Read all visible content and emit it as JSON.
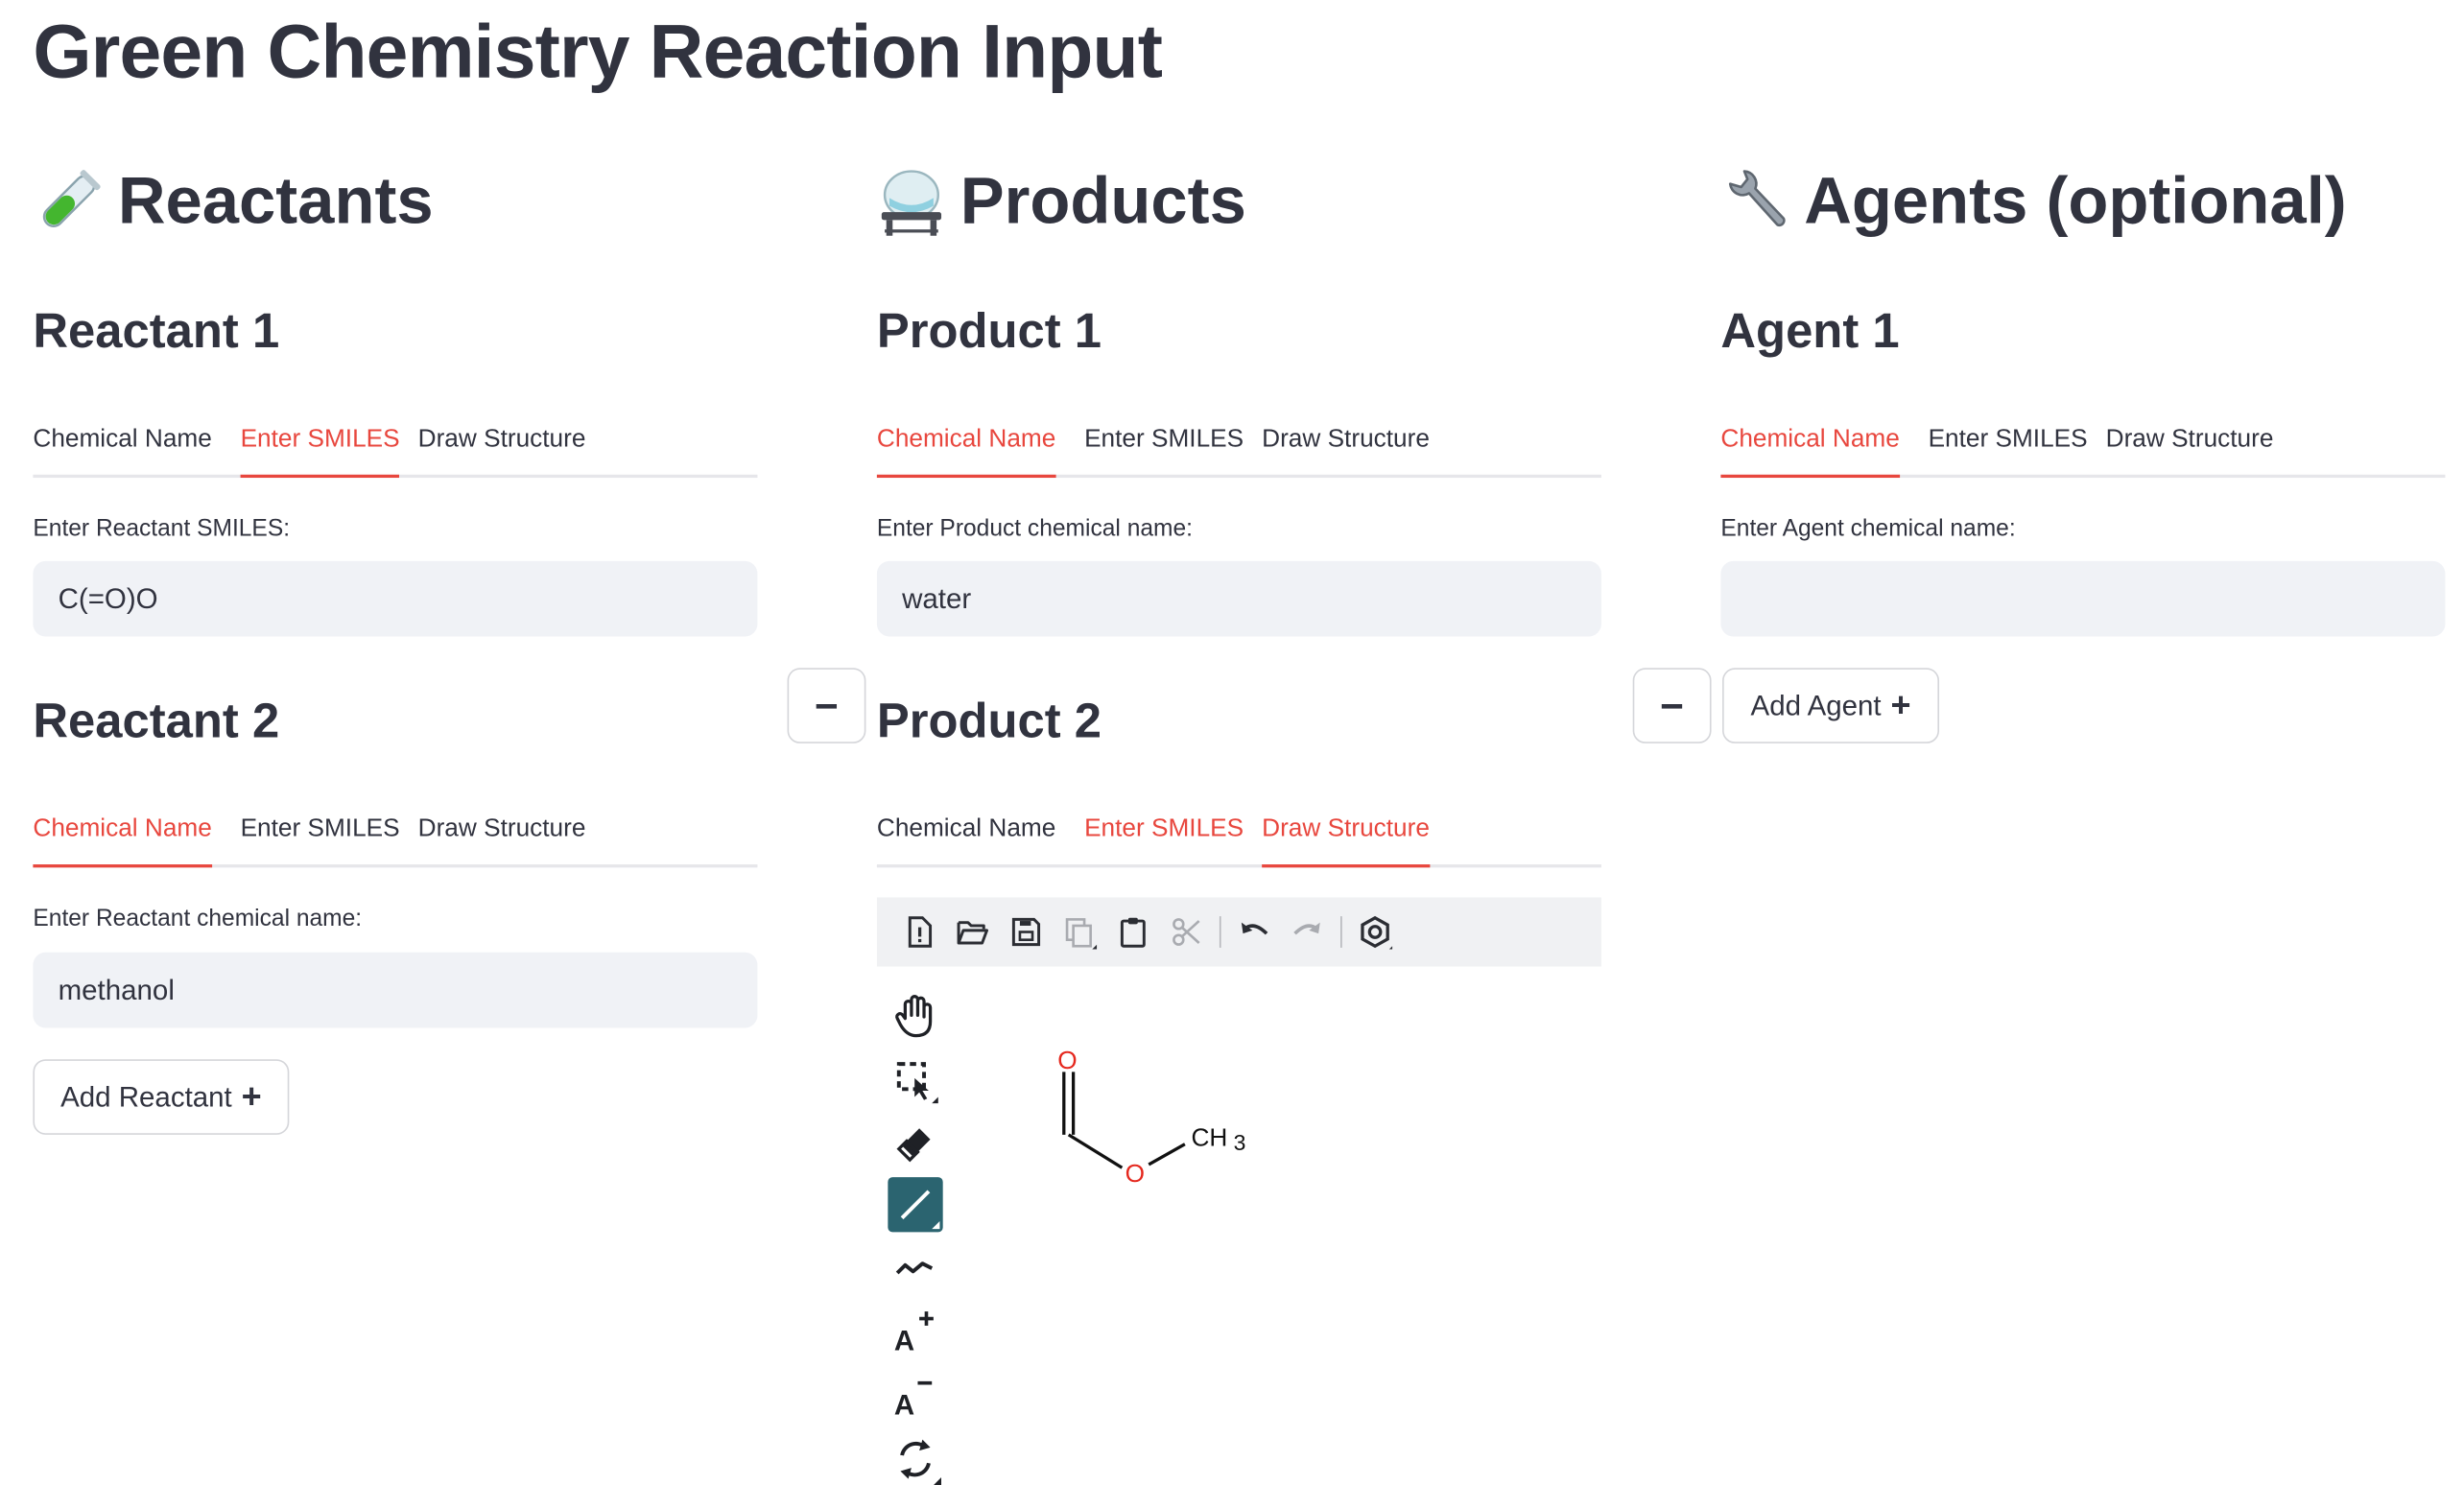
{
  "page": {
    "title": "Green Chemistry Reaction Input"
  },
  "columns": {
    "reactants": {
      "heading": "Reactants",
      "icon": "test-tube-icon",
      "items": [
        {
          "title": "Reactant 1",
          "tabs": [
            "Chemical Name",
            "Enter SMILES",
            "Draw Structure"
          ],
          "active_tab": "Enter SMILES",
          "field_label": "Enter Reactant SMILES:",
          "field_value": "C(=O)O"
        },
        {
          "title": "Reactant 2",
          "tabs": [
            "Chemical Name",
            "Enter SMILES",
            "Draw Structure"
          ],
          "active_tab": "Chemical Name",
          "field_label": "Enter Reactant chemical name:",
          "field_value": "methanol"
        }
      ],
      "add_button": "Add Reactant"
    },
    "products": {
      "heading": "Products",
      "icon": "alembic-icon",
      "items": [
        {
          "title": "Product 1",
          "tabs": [
            "Chemical Name",
            "Enter SMILES",
            "Draw Structure"
          ],
          "active_tab": "Chemical Name",
          "field_label": "Enter Product chemical name:",
          "field_value": "water"
        },
        {
          "title": "Product 2",
          "tabs": [
            "Chemical Name",
            "Enter SMILES",
            "Draw Structure"
          ],
          "active_tab": "Draw Structure",
          "highlighted_tabs": [
            "Enter SMILES",
            "Draw Structure"
          ]
        }
      ],
      "remove_button": "−"
    },
    "agents": {
      "heading": "Agents (optional)",
      "icon": "wrench-icon",
      "items": [
        {
          "title": "Agent 1",
          "tabs": [
            "Chemical Name",
            "Enter SMILES",
            "Draw Structure"
          ],
          "active_tab": "Chemical Name",
          "field_label": "Enter Agent chemical name:",
          "field_value": ""
        }
      ],
      "remove_button": "−",
      "add_button": "Add Agent"
    }
  },
  "editor": {
    "toolbar_icons": [
      "new-document-icon",
      "open-folder-icon",
      "save-icon",
      "copy-icon",
      "paste-icon",
      "cut-icon",
      "undo-icon",
      "redo-icon",
      "settings-icon"
    ],
    "side_tools": [
      "hand-icon",
      "select-icon",
      "eraser-icon",
      "bond-icon",
      "chain-icon",
      "charge-plus-icon",
      "charge-minus-icon",
      "rotate-icon"
    ],
    "molecule": {
      "atoms": [
        "O",
        "O",
        "CH",
        "3"
      ]
    },
    "colors": {
      "accent": "#e8473e",
      "selected_tool": "#2b6470",
      "heteroatom": "#e5281e"
    }
  }
}
